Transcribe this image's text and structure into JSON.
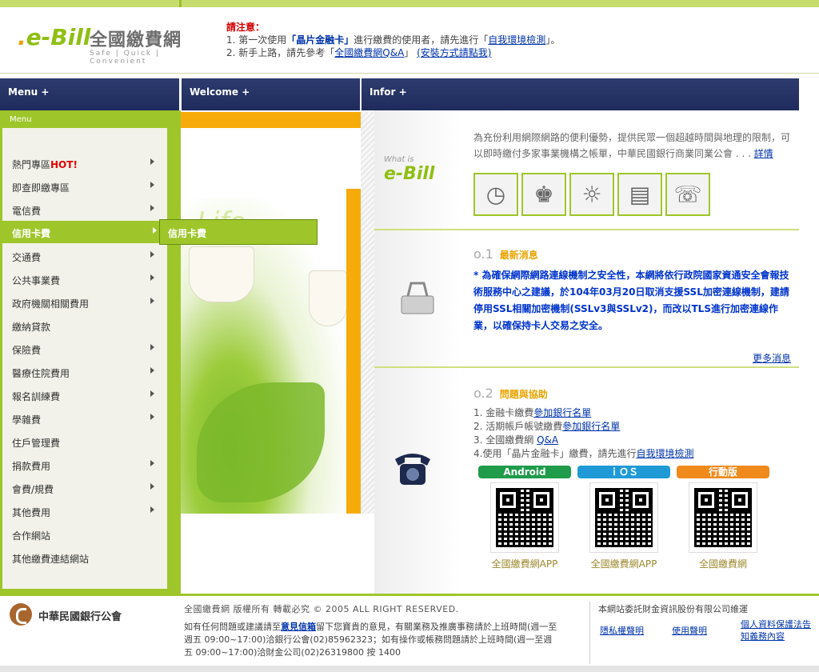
{
  "brand": {
    "logo_text": "e-Bill",
    "name": "全國繳費網",
    "slogan": "Safe | Quick | Convenient"
  },
  "notice": {
    "title": "請注意：",
    "line1_prefix": "1. 第一次使用",
    "line1_highlight": "「晶片金融卡」",
    "line1_mid": "進行繳費的使用者，請先進行「",
    "line1_link": "自我環境檢測",
    "line1_suffix": "」。",
    "line2_prefix": "2. 新手上路，請先參考「",
    "line2_link1": "全國繳費網Q&A",
    "line2_mid": "」",
    "line2_link2": "(安裝方式請點我)"
  },
  "tabs": {
    "menu": "Menu +",
    "welcome": "Welcome +",
    "infor": "Infor +"
  },
  "menu": {
    "header": "Menu",
    "items": [
      {
        "label": "熱門專區",
        "hot": "HOT!",
        "arrow": true
      },
      {
        "label": "即查即繳專區",
        "arrow": true
      },
      {
        "label": "電信費",
        "arrow": true
      },
      {
        "label": "信用卡費",
        "arrow": true,
        "active": true
      },
      {
        "label": "交通費",
        "arrow": true
      },
      {
        "label": "公共事業費",
        "arrow": true
      },
      {
        "label": "政府機關相關費用",
        "arrow": true
      },
      {
        "label": "繳納貸款",
        "arrow": false
      },
      {
        "label": "保險費",
        "arrow": true
      },
      {
        "label": "醫療住院費用",
        "arrow": true
      },
      {
        "label": "報名訓練費",
        "arrow": true
      },
      {
        "label": "學雜費",
        "arrow": true
      },
      {
        "label": "住戶管理費",
        "arrow": false
      },
      {
        "label": "捐款費用",
        "arrow": true
      },
      {
        "label": "會費/規費",
        "arrow": true
      },
      {
        "label": "其他費用",
        "arrow": true
      },
      {
        "label": "合作網站",
        "arrow": false
      },
      {
        "label": "其他繳費連結網站",
        "arrow": false
      }
    ],
    "submenu_label": "信用卡費"
  },
  "welcome": {
    "deco_text": "Life"
  },
  "info": {
    "whatis_small": "What is",
    "whatis_big": "e-Bill",
    "intro": "為充份利用網際網路的便利優勢，提供民眾一個超越時間與地理的限制，可以即時繳付多家事業機構之帳單，中華民國銀行商業同業公會 . . .",
    "intro_link": "詳情",
    "thumb_icons": [
      "clock-icon",
      "faucet-icon",
      "lightbulb-icon",
      "card-reader-icon",
      "phone-icon"
    ],
    "news": {
      "num": "o.1",
      "title": "最新消息",
      "text": "* 為確保網際網路連線機制之安全性，本網將依行政院國家資通安全會報技術服務中心之建議，於104年03月20日取消支援SSL加密連線機制，建請停用SSL相關加密機制(SSLv3與SSLv2)，而改以TLS進行加密連線作業，以確保持卡人交易之安全。",
      "more": "更多消息"
    },
    "help": {
      "num": "o.2",
      "title": "問題與協助",
      "line1_text": "1. 金融卡繳費",
      "line1_link": "參加銀行名單",
      "line2_text": "2. 活期帳戶帳號繳費",
      "line2_link": "參加銀行名單",
      "line3_text": "3. 全國繳費網 ",
      "line3_link": "Q&A",
      "line4_text": "4.使用「晶片金融卡」繳費，請先進行",
      "line4_link": "自我環境檢測"
    },
    "apps": [
      {
        "label": "Android",
        "color": "#1f9b4a",
        "caption": "全國繳費網APP"
      },
      {
        "label": "ｉＯＳ",
        "color": "#1f9ad6",
        "caption": "全國繳費網APP"
      },
      {
        "label": "行動版",
        "color": "#f08a1c",
        "caption": "全國繳費網"
      }
    ]
  },
  "footer": {
    "org_name": "中華民國銀行公會",
    "copyright": "全國繳費網 版權所有 轉載必究 © 2005 ALL RIGHT RESERVED.",
    "contact_prefix": "如有任何問題或建議請至",
    "contact_link": "意見信箱",
    "contact_text": "留下您寶貴的意見，有關業務及推廣事務請於上班時間(週一至週五 09:00~17:00)洽銀行公會(02)85962323；如有操作或帳務問題請於上班時間(週一至週五 09:00~17:00)洽財金公司(02)26319800 按 1400",
    "maintainer": "本網站委託財金資訊股份有限公司維運",
    "privacy": "隱私權聲明",
    "terms": "使用聲明",
    "personal_data": "個人資料保護法告知義務內容"
  }
}
